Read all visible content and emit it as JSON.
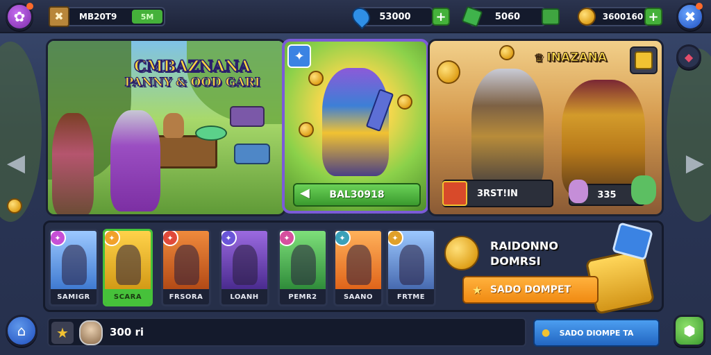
{
  "topbar": {
    "menu_icon": "flower-icon",
    "player_label": "MB20T9",
    "player_value": "5M",
    "gems": "53000",
    "cash": "5060",
    "gold": "3600160",
    "close_icon": "close-icon",
    "plus_label": "+"
  },
  "banner_left": {
    "title_line1": "CMBAZNANA",
    "title_line2": "PANNY & OOD GARI"
  },
  "banner_center": {
    "button_label": "BAL30918"
  },
  "banner_right": {
    "title": "INAZANA",
    "stat_label": "3RST!IN",
    "stat_value": "335"
  },
  "heroes": [
    {
      "label": "SAMIGR"
    },
    {
      "label": "SCARA"
    },
    {
      "label": "FRSORA"
    },
    {
      "label": "LOANH"
    },
    {
      "label": "PEMR2"
    },
    {
      "label": "SAANO"
    },
    {
      "label": "FRTME"
    }
  ],
  "promo": {
    "title_line1": "RAIDONNO",
    "title_line2": "DOMRSI",
    "button_label": "SADO DOMPET"
  },
  "bottom": {
    "player_count": "300 ri",
    "action_label": "SADO DIOMPE TA"
  },
  "colors": {
    "accent_green": "#45b13a",
    "accent_orange": "#f39a1e",
    "accent_blue": "#2f7fd6",
    "gold": "#f1c232"
  }
}
